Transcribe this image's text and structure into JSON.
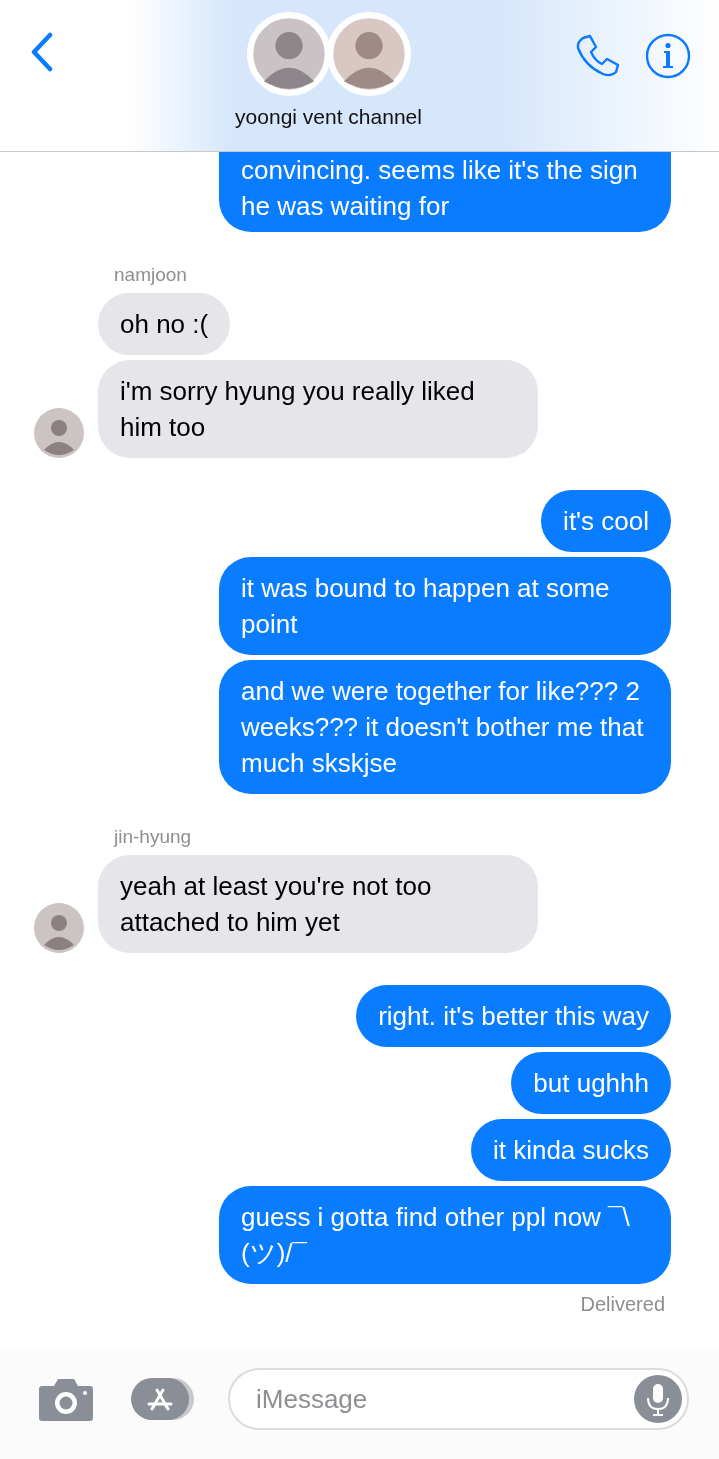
{
  "header": {
    "title": "yoongi vent channel"
  },
  "groups": [
    {
      "kind": "sent",
      "cut": true,
      "messages": [
        "convincing. seems like it's the sign he was waiting for"
      ]
    },
    {
      "kind": "received",
      "sender": "namjoon",
      "messages": [
        "oh no :(",
        "i'm sorry hyung you really liked him too"
      ]
    },
    {
      "kind": "sent",
      "messages": [
        "it's cool",
        "it was bound to happen at some point",
        "and we were together for like??? 2 weeks??? it doesn't bother me that much skskjse"
      ]
    },
    {
      "kind": "received",
      "sender": "jin-hyung",
      "messages": [
        "yeah at least you're not too attached to him yet"
      ]
    },
    {
      "kind": "sent",
      "messages": [
        "right. it's better this way",
        "but ughhh",
        "it kinda sucks",
        "guess i gotta find other ppl now ¯\\(ツ)/¯"
      ],
      "status": "Delivered"
    }
  ],
  "composer": {
    "placeholder": "iMessage"
  }
}
